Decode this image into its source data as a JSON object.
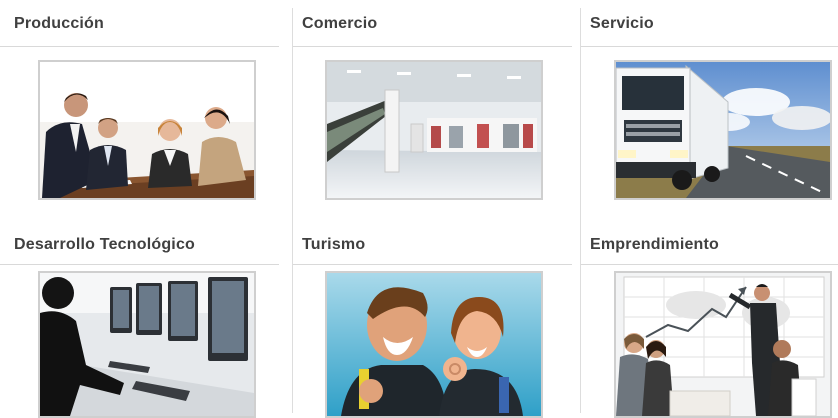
{
  "categories": [
    {
      "title": "Producción",
      "image": "business-meeting"
    },
    {
      "title": "Comercio",
      "image": "shopping-mall"
    },
    {
      "title": "Servicio",
      "image": "truck-highway"
    },
    {
      "title": "Desarrollo Tecnológico",
      "image": "computer-lab"
    },
    {
      "title": "Turismo",
      "image": "scuba-divers"
    },
    {
      "title": "Emprendimiento",
      "image": "presentation-chart"
    }
  ]
}
